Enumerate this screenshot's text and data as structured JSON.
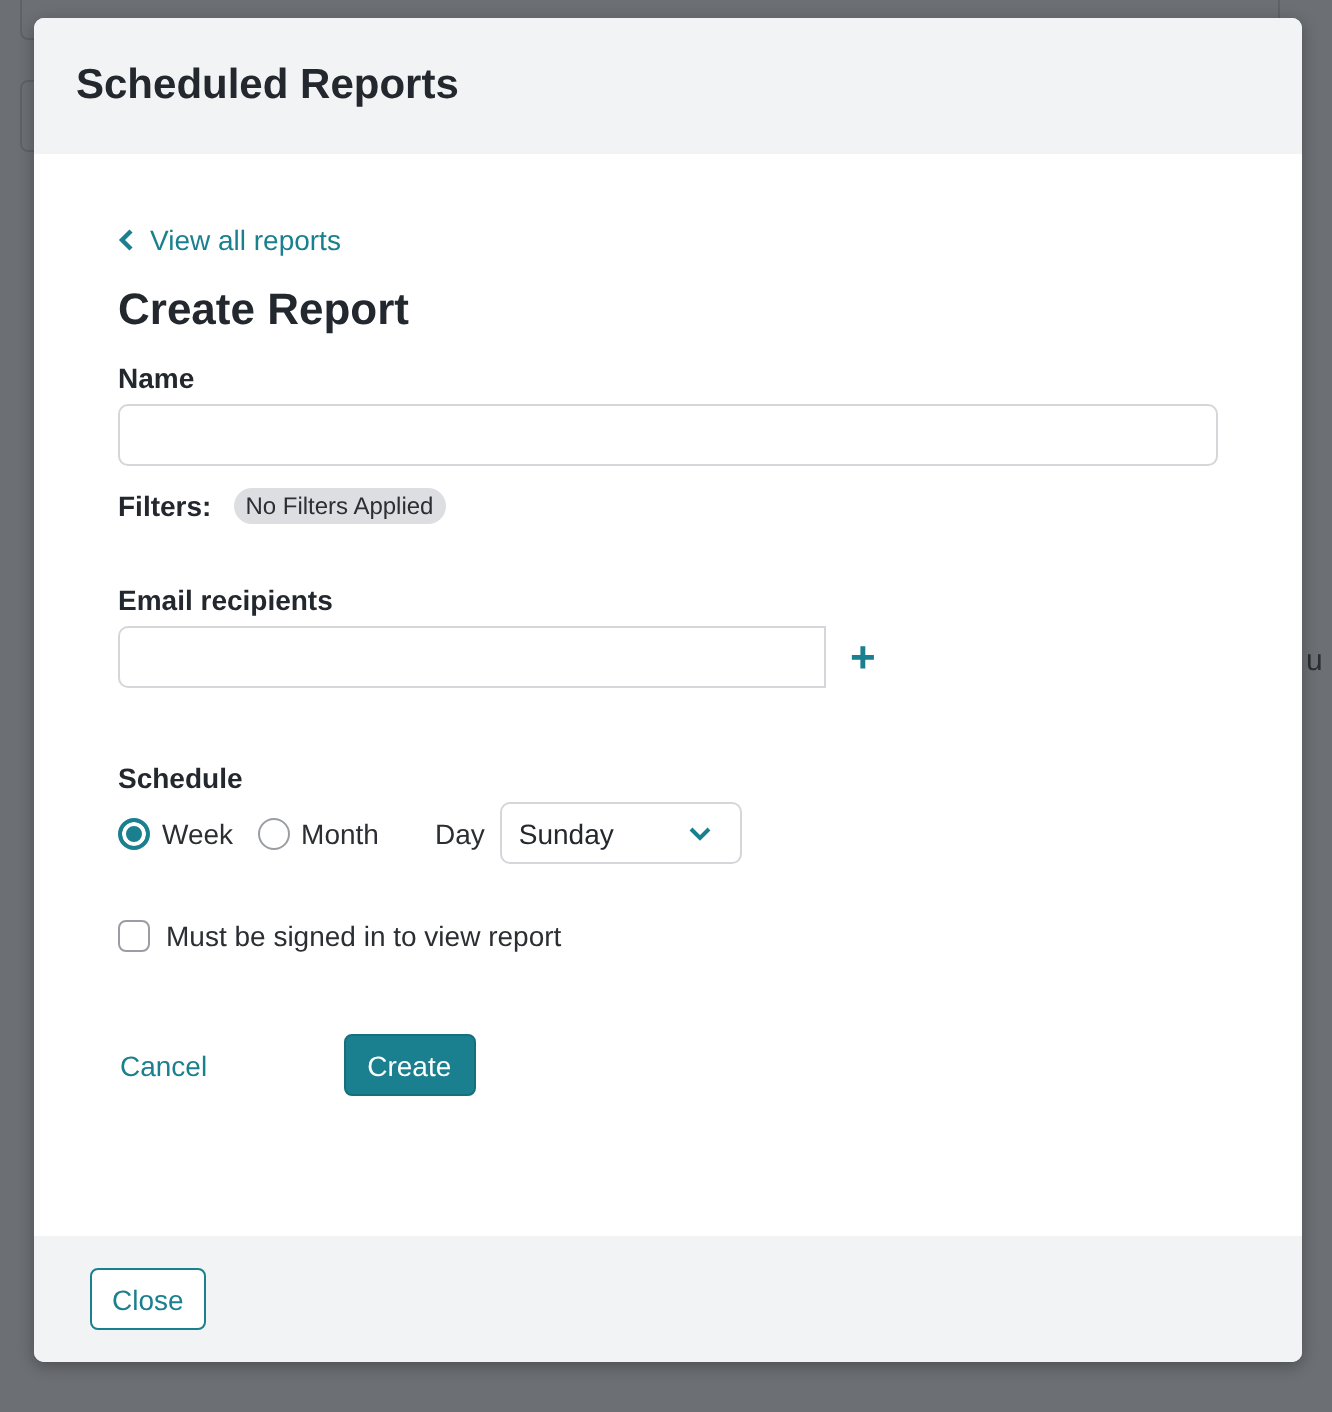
{
  "background": {
    "side_fragment": "u"
  },
  "modal": {
    "title": "Scheduled Reports",
    "back_link": "View all reports",
    "heading": "Create Report",
    "name_field": {
      "label": "Name"
    },
    "filters": {
      "label": "Filters:",
      "badge": "No Filters Applied"
    },
    "email_field": {
      "label": "Email recipients",
      "add": "+"
    },
    "schedule": {
      "label": "Schedule",
      "options": [
        {
          "label": "Week",
          "selected": true
        },
        {
          "label": "Month",
          "selected": false
        }
      ],
      "day_label": "Day",
      "day_value": "Sunday"
    },
    "signed_in": {
      "label": "Must be signed in to view report",
      "checked": false
    },
    "actions": {
      "cancel": "Cancel",
      "create": "Create"
    },
    "footer": {
      "close": "Close"
    }
  }
}
